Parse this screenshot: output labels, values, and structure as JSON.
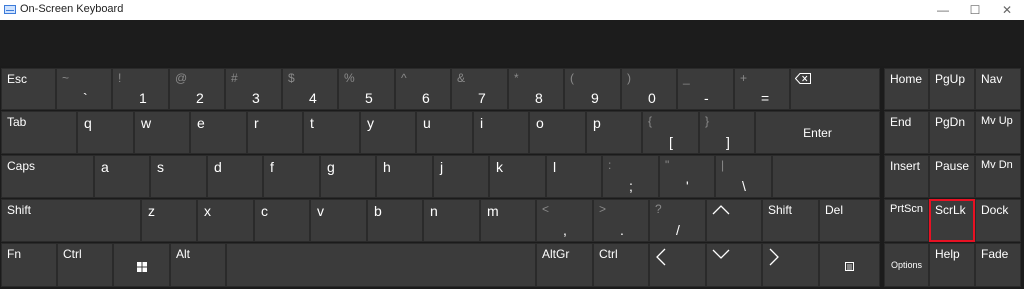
{
  "window": {
    "title": "On-Screen Keyboard",
    "minimize": "—",
    "maximize": "☐",
    "close": "✕"
  },
  "keys": {
    "esc": "Esc",
    "n1": {
      "shift": "~",
      "main": "`"
    },
    "n2": {
      "shift": "!",
      "main": "1"
    },
    "n3": {
      "shift": "@",
      "main": "2"
    },
    "n4": {
      "shift": "#",
      "main": "3"
    },
    "n5": {
      "shift": "$",
      "main": "4"
    },
    "n6": {
      "shift": "%",
      "main": "5"
    },
    "n7": {
      "shift": "^",
      "main": "6"
    },
    "n8": {
      "shift": "&",
      "main": "7"
    },
    "n9": {
      "shift": "*",
      "main": "8"
    },
    "n10": {
      "shift": "(",
      "main": "9"
    },
    "n11": {
      "shift": ")",
      "main": "0"
    },
    "n12": {
      "shift": "_",
      "main": "-"
    },
    "n13": {
      "shift": "+",
      "main": "="
    },
    "home": "Home",
    "pgup": "PgUp",
    "nav": "Nav",
    "tab": "Tab",
    "q": "q",
    "w": "w",
    "e": "e",
    "r": "r",
    "t": "t",
    "y": "y",
    "u": "u",
    "i": "i",
    "o": "o",
    "p": "p",
    "lbracket": {
      "shift": "{",
      "main": "["
    },
    "rbracket": {
      "shift": "}",
      "main": "]"
    },
    "enter": "Enter",
    "end": "End",
    "pgdn": "PgDn",
    "mvup": "Mv Up",
    "caps": "Caps",
    "a": "a",
    "s": "s",
    "d": "d",
    "f": "f",
    "g": "g",
    "h": "h",
    "j": "j",
    "k": "k",
    "l": "l",
    "semicolon": {
      "shift": ":",
      "main": ";"
    },
    "quote": {
      "shift": "\"",
      "main": "'"
    },
    "backslash": {
      "shift": "|",
      "main": "\\"
    },
    "insert": "Insert",
    "pause": "Pause",
    "mvdn": "Mv Dn",
    "lshift": "Shift",
    "z": "z",
    "x": "x",
    "c": "c",
    "v": "v",
    "b": "b",
    "n": "n",
    "m": "m",
    "comma": {
      "shift": "<",
      "main": ","
    },
    "period": {
      "shift": ">",
      "main": "."
    },
    "slash": {
      "shift": "?",
      "main": "/"
    },
    "rshift": "Shift",
    "del": "Del",
    "prtscn": "PrtScn",
    "scrlk": "ScrLk",
    "dock": "Dock",
    "fn": "Fn",
    "lctrl": "Ctrl",
    "alt": "Alt",
    "altgr": "AltGr",
    "rctrl": "Ctrl",
    "options": "Options",
    "help": "Help",
    "fade": "Fade"
  },
  "selected_key": "ScrLk",
  "colors": {
    "background": "#1b1b1b",
    "key": "#3b3b3b",
    "key_text": "#ffffff",
    "shift_text": "#8a8a8a",
    "selected_outline": "#e81123"
  }
}
